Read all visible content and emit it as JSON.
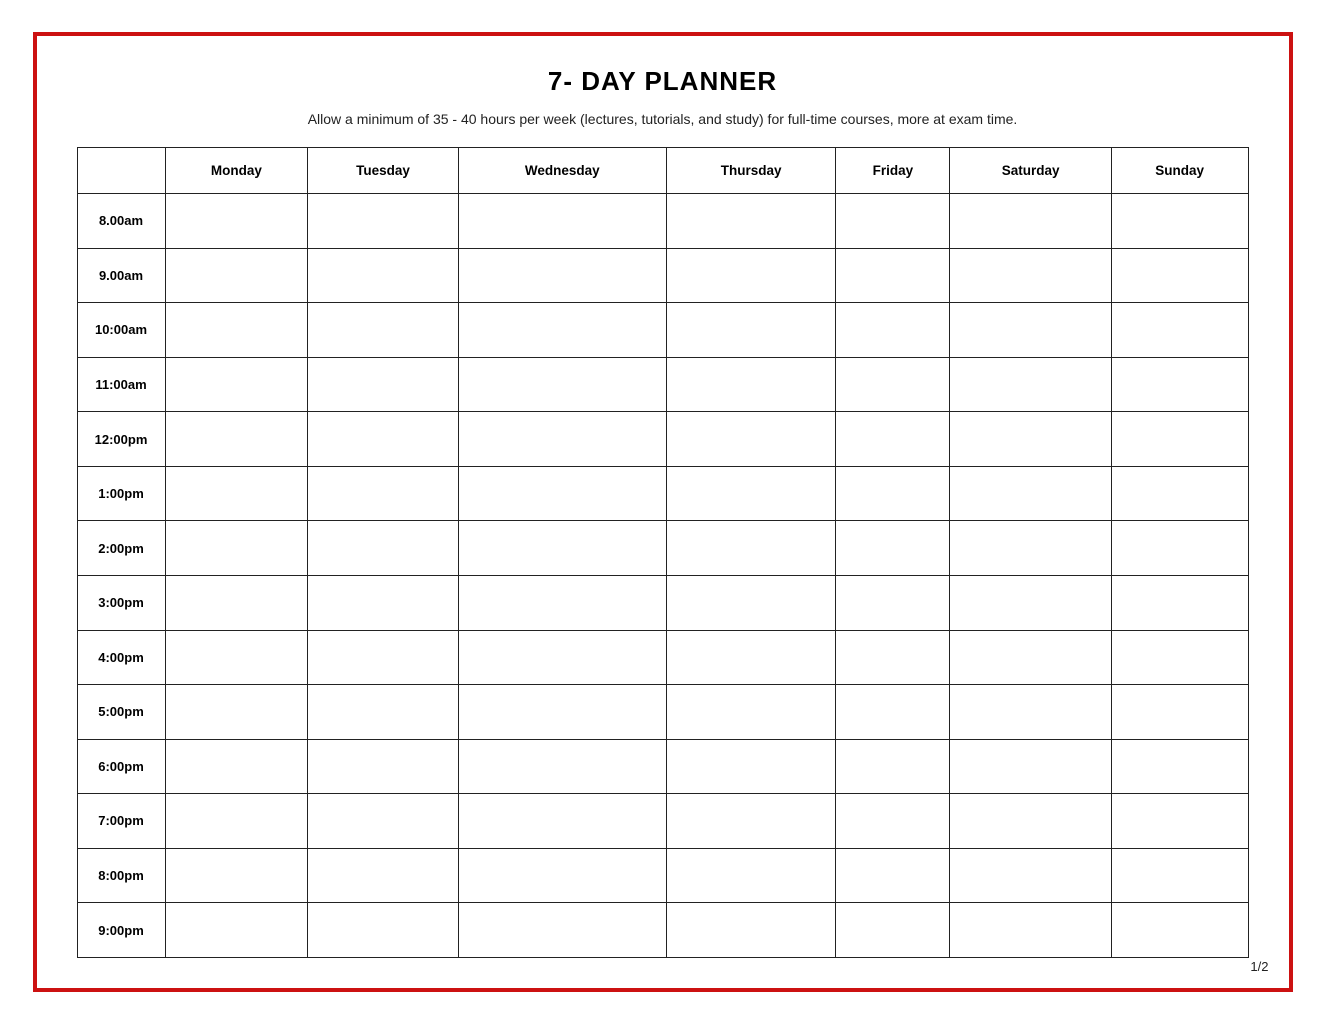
{
  "title": "7- DAY PLANNER",
  "subtitle": "Allow a minimum of 35 - 40 hours per week (lectures, tutorials, and study) for full-time courses, more at exam time.",
  "days": [
    "Monday",
    "Tuesday",
    "Wednesday",
    "Thursday",
    "Friday",
    "Saturday",
    "Sunday"
  ],
  "times": [
    "8.00am",
    "9.00am",
    "10:00am",
    "11:00am",
    "12:00pm",
    "1:00pm",
    "2:00pm",
    "3:00pm",
    "4:00pm",
    "5:00pm",
    "6:00pm",
    "7:00pm",
    "8:00pm",
    "9:00pm"
  ],
  "page_number": "1/2"
}
